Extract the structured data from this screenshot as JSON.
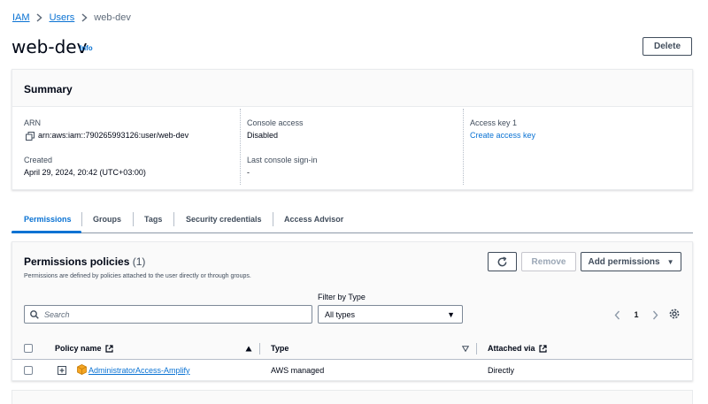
{
  "breadcrumb": {
    "iam": "IAM",
    "users": "Users",
    "current": "web-dev"
  },
  "header": {
    "title": "web-dev",
    "info": "Info",
    "delete_label": "Delete"
  },
  "summary": {
    "title": "Summary",
    "arn_label": "ARN",
    "arn_value": "arn:aws:iam::790265993126:user/web-dev",
    "created_label": "Created",
    "created_value": "April 29, 2024, 20:42 (UTC+03:00)",
    "console_access_label": "Console access",
    "console_access_value": "Disabled",
    "last_signin_label": "Last console sign-in",
    "last_signin_value": "-",
    "access_key_label": "Access key 1",
    "access_key_link": "Create access key"
  },
  "tabs": [
    {
      "label": "Permissions",
      "active": true
    },
    {
      "label": "Groups",
      "active": false
    },
    {
      "label": "Tags",
      "active": false
    },
    {
      "label": "Security credentials",
      "active": false
    },
    {
      "label": "Access Advisor",
      "active": false
    }
  ],
  "permissions": {
    "title": "Permissions policies",
    "count": "(1)",
    "description": "Permissions are defined by policies attached to the user directly or through groups.",
    "remove_label": "Remove",
    "add_label": "Add permissions",
    "search_placeholder": "Search",
    "filter_label": "Filter by Type",
    "filter_value": "All types",
    "page": "1",
    "columns": {
      "policy_name": "Policy name",
      "type": "Type",
      "attached_via": "Attached via"
    },
    "rows": [
      {
        "policy_name": "AdministratorAccess-Amplify",
        "type": "AWS managed",
        "attached_via": "Directly"
      }
    ]
  },
  "colors": {
    "link": "#0972d3",
    "border": "#414d5c",
    "policy_icon": "#f5a623"
  }
}
